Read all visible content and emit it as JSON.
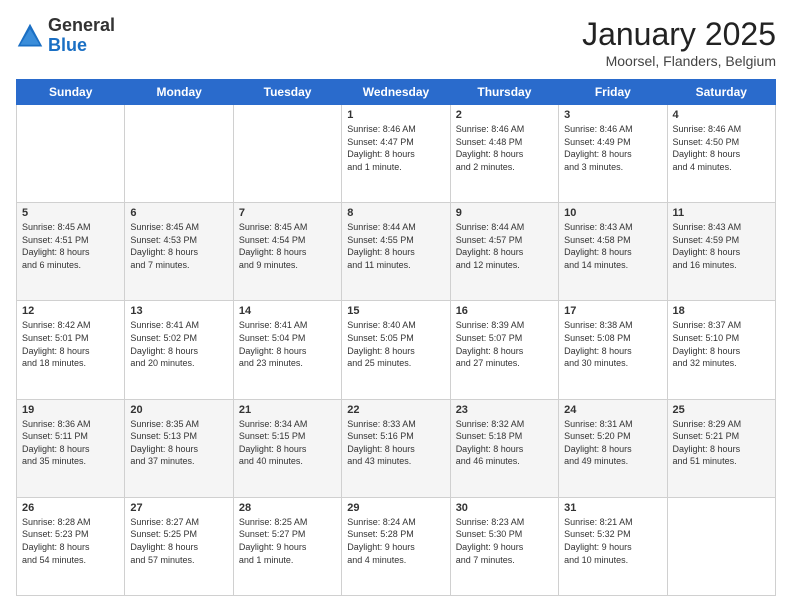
{
  "header": {
    "logo_general": "General",
    "logo_blue": "Blue",
    "month": "January 2025",
    "location": "Moorsel, Flanders, Belgium"
  },
  "days_of_week": [
    "Sunday",
    "Monday",
    "Tuesday",
    "Wednesday",
    "Thursday",
    "Friday",
    "Saturday"
  ],
  "weeks": [
    [
      {
        "day": "",
        "info": ""
      },
      {
        "day": "",
        "info": ""
      },
      {
        "day": "",
        "info": ""
      },
      {
        "day": "1",
        "info": "Sunrise: 8:46 AM\nSunset: 4:47 PM\nDaylight: 8 hours\nand 1 minute."
      },
      {
        "day": "2",
        "info": "Sunrise: 8:46 AM\nSunset: 4:48 PM\nDaylight: 8 hours\nand 2 minutes."
      },
      {
        "day": "3",
        "info": "Sunrise: 8:46 AM\nSunset: 4:49 PM\nDaylight: 8 hours\nand 3 minutes."
      },
      {
        "day": "4",
        "info": "Sunrise: 8:46 AM\nSunset: 4:50 PM\nDaylight: 8 hours\nand 4 minutes."
      }
    ],
    [
      {
        "day": "5",
        "info": "Sunrise: 8:45 AM\nSunset: 4:51 PM\nDaylight: 8 hours\nand 6 minutes."
      },
      {
        "day": "6",
        "info": "Sunrise: 8:45 AM\nSunset: 4:53 PM\nDaylight: 8 hours\nand 7 minutes."
      },
      {
        "day": "7",
        "info": "Sunrise: 8:45 AM\nSunset: 4:54 PM\nDaylight: 8 hours\nand 9 minutes."
      },
      {
        "day": "8",
        "info": "Sunrise: 8:44 AM\nSunset: 4:55 PM\nDaylight: 8 hours\nand 11 minutes."
      },
      {
        "day": "9",
        "info": "Sunrise: 8:44 AM\nSunset: 4:57 PM\nDaylight: 8 hours\nand 12 minutes."
      },
      {
        "day": "10",
        "info": "Sunrise: 8:43 AM\nSunset: 4:58 PM\nDaylight: 8 hours\nand 14 minutes."
      },
      {
        "day": "11",
        "info": "Sunrise: 8:43 AM\nSunset: 4:59 PM\nDaylight: 8 hours\nand 16 minutes."
      }
    ],
    [
      {
        "day": "12",
        "info": "Sunrise: 8:42 AM\nSunset: 5:01 PM\nDaylight: 8 hours\nand 18 minutes."
      },
      {
        "day": "13",
        "info": "Sunrise: 8:41 AM\nSunset: 5:02 PM\nDaylight: 8 hours\nand 20 minutes."
      },
      {
        "day": "14",
        "info": "Sunrise: 8:41 AM\nSunset: 5:04 PM\nDaylight: 8 hours\nand 23 minutes."
      },
      {
        "day": "15",
        "info": "Sunrise: 8:40 AM\nSunset: 5:05 PM\nDaylight: 8 hours\nand 25 minutes."
      },
      {
        "day": "16",
        "info": "Sunrise: 8:39 AM\nSunset: 5:07 PM\nDaylight: 8 hours\nand 27 minutes."
      },
      {
        "day": "17",
        "info": "Sunrise: 8:38 AM\nSunset: 5:08 PM\nDaylight: 8 hours\nand 30 minutes."
      },
      {
        "day": "18",
        "info": "Sunrise: 8:37 AM\nSunset: 5:10 PM\nDaylight: 8 hours\nand 32 minutes."
      }
    ],
    [
      {
        "day": "19",
        "info": "Sunrise: 8:36 AM\nSunset: 5:11 PM\nDaylight: 8 hours\nand 35 minutes."
      },
      {
        "day": "20",
        "info": "Sunrise: 8:35 AM\nSunset: 5:13 PM\nDaylight: 8 hours\nand 37 minutes."
      },
      {
        "day": "21",
        "info": "Sunrise: 8:34 AM\nSunset: 5:15 PM\nDaylight: 8 hours\nand 40 minutes."
      },
      {
        "day": "22",
        "info": "Sunrise: 8:33 AM\nSunset: 5:16 PM\nDaylight: 8 hours\nand 43 minutes."
      },
      {
        "day": "23",
        "info": "Sunrise: 8:32 AM\nSunset: 5:18 PM\nDaylight: 8 hours\nand 46 minutes."
      },
      {
        "day": "24",
        "info": "Sunrise: 8:31 AM\nSunset: 5:20 PM\nDaylight: 8 hours\nand 49 minutes."
      },
      {
        "day": "25",
        "info": "Sunrise: 8:29 AM\nSunset: 5:21 PM\nDaylight: 8 hours\nand 51 minutes."
      }
    ],
    [
      {
        "day": "26",
        "info": "Sunrise: 8:28 AM\nSunset: 5:23 PM\nDaylight: 8 hours\nand 54 minutes."
      },
      {
        "day": "27",
        "info": "Sunrise: 8:27 AM\nSunset: 5:25 PM\nDaylight: 8 hours\nand 57 minutes."
      },
      {
        "day": "28",
        "info": "Sunrise: 8:25 AM\nSunset: 5:27 PM\nDaylight: 9 hours\nand 1 minute."
      },
      {
        "day": "29",
        "info": "Sunrise: 8:24 AM\nSunset: 5:28 PM\nDaylight: 9 hours\nand 4 minutes."
      },
      {
        "day": "30",
        "info": "Sunrise: 8:23 AM\nSunset: 5:30 PM\nDaylight: 9 hours\nand 7 minutes."
      },
      {
        "day": "31",
        "info": "Sunrise: 8:21 AM\nSunset: 5:32 PM\nDaylight: 9 hours\nand 10 minutes."
      },
      {
        "day": "",
        "info": ""
      }
    ]
  ]
}
